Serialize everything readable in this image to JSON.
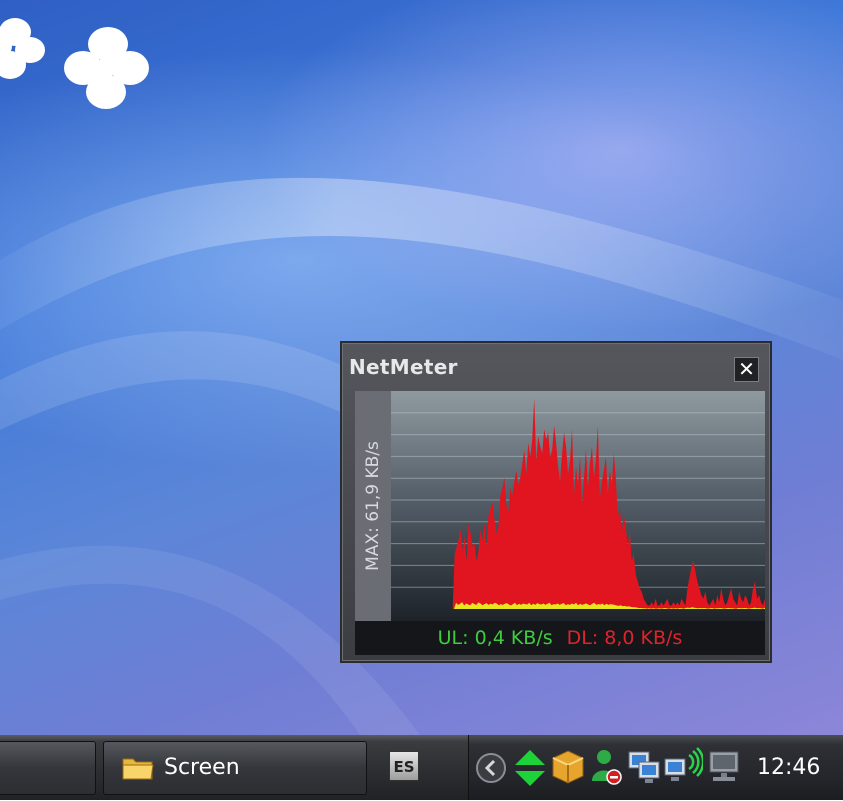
{
  "netmeter": {
    "title": "NetMeter",
    "close_symbol": "✕",
    "max_label": "MAX: 61,9 KB/s",
    "upload_text": "UL: 0,4 KB/s",
    "download_text": "DL: 8,0 KB/s",
    "colors": {
      "download": "#e0151f",
      "upload": "#e8e61e",
      "ul_text": "#3fcc3f",
      "dl_text": "#e0232b"
    }
  },
  "chart_data": {
    "type": "area",
    "grid": true,
    "ylim": [
      0,
      61.9
    ],
    "series": [
      {
        "values": [
          0,
          0,
          0,
          0,
          0,
          0,
          0,
          0,
          0,
          0,
          0,
          0,
          0,
          0,
          0,
          0,
          0,
          0,
          0,
          0,
          0,
          0,
          0,
          0,
          0,
          0,
          0,
          0,
          0,
          0,
          0,
          0,
          16,
          18,
          20,
          23,
          17,
          21,
          14,
          25,
          22,
          18,
          19,
          14,
          17,
          23,
          20,
          25,
          18,
          27,
          29,
          31,
          26,
          22,
          24,
          33,
          35,
          38,
          30,
          28,
          35,
          33,
          37,
          40,
          36,
          38,
          42,
          46,
          39,
          48,
          44,
          49,
          61,
          43,
          50,
          47,
          45,
          52,
          49,
          51,
          44,
          46,
          53,
          48,
          41,
          37,
          45,
          51,
          47,
          39,
          43,
          52,
          33,
          41,
          36,
          44,
          30,
          38,
          46,
          35,
          42,
          47,
          38,
          43,
          53,
          32,
          37,
          40,
          44,
          33,
          40,
          36,
          45,
          38,
          26,
          30,
          22,
          27,
          24,
          18,
          23,
          14,
          16,
          10,
          8,
          6,
          5,
          3,
          2,
          1,
          1,
          2,
          1,
          3,
          1,
          1,
          2,
          1,
          2,
          3,
          1,
          1,
          2,
          1,
          2,
          1,
          3,
          2,
          1,
          6,
          9,
          12,
          14,
          11,
          8,
          6,
          4,
          3,
          5,
          2,
          1,
          2,
          3,
          1,
          4,
          2,
          6,
          3,
          1,
          2,
          4,
          6,
          3,
          2,
          1,
          5,
          3,
          2,
          4,
          3,
          1,
          2,
          6,
          8,
          3,
          4,
          2,
          1,
          3
        ]
      },
      {
        "values": [
          0,
          0,
          0,
          0,
          0,
          0,
          0,
          0,
          0,
          0,
          0,
          0,
          0,
          0,
          0,
          0,
          0,
          0,
          0,
          0,
          0,
          0,
          0,
          0,
          0,
          0,
          0,
          0,
          0,
          0,
          0,
          0,
          1.8,
          1.2,
          1.5,
          2.0,
          1.0,
          1.6,
          1.3,
          1.1,
          1.8,
          1.4,
          1.2,
          1.9,
          1.6,
          1.1,
          1.4,
          1.7,
          1.2,
          1.5,
          1.3,
          1.8,
          1.6,
          1.1,
          1.4,
          1.2,
          1.5,
          1.7,
          1.3,
          1.0,
          1.4,
          1.8,
          1.1,
          1.5,
          1.2,
          1.6,
          1.4,
          1.3,
          1.8,
          1.1,
          1.5,
          1.2,
          1.7,
          1.4,
          1.3,
          1.6,
          1.2,
          1.5,
          1.8,
          1.1,
          1.4,
          1.3,
          1.6,
          1.2,
          1.5,
          1.7,
          1.1,
          1.4,
          1.2,
          1.6,
          1.3,
          1.8,
          1.1,
          1.5,
          1.2,
          1.4,
          1.6,
          1.3,
          1.1,
          1.5,
          1.8,
          1.2,
          1.4,
          1.3,
          1.6,
          1.1,
          1.5,
          1.2,
          1.4,
          1.3,
          1.2,
          1.0,
          0.9,
          1.1,
          0.8,
          0.9,
          0.7,
          0.8,
          0.6,
          0.5,
          0.5,
          0.4,
          0.3,
          0.3,
          0.2,
          0.2,
          0.1,
          0.2,
          0.1,
          0.2,
          0.1,
          0.1,
          0.2,
          0.1,
          0.2,
          0.3,
          0.1,
          0.1,
          0.2,
          0.1,
          0.2,
          0.1,
          0.3,
          0.2,
          0.1,
          0.3,
          0.4,
          0.3,
          0.5,
          0.4,
          0.3,
          0.2,
          0.3,
          0.2,
          0.3,
          0.2,
          0.1,
          0.2,
          0.3,
          0.1,
          0.2,
          0.2,
          0.3,
          0.2,
          0.1,
          0.2,
          0.3,
          0.2,
          0.2,
          0.1,
          0.1,
          0.3,
          0.2,
          0.2,
          0.3,
          0.2,
          0.1,
          0.2,
          0.3,
          0.4,
          0.2,
          0.3,
          0.2,
          0.1,
          0.4
        ]
      }
    ]
  },
  "taskbar": {
    "left_button_label": "",
    "screen_button_label": "Screen",
    "language_indicator": "ES",
    "clock": "12:46",
    "tray_icons": [
      "chevron-left-icon",
      "network-updown-icon",
      "package-icon",
      "user-status-icon",
      "monitor-computers-icon",
      "wireless-network-icon",
      "network-disconnected-icon"
    ]
  }
}
